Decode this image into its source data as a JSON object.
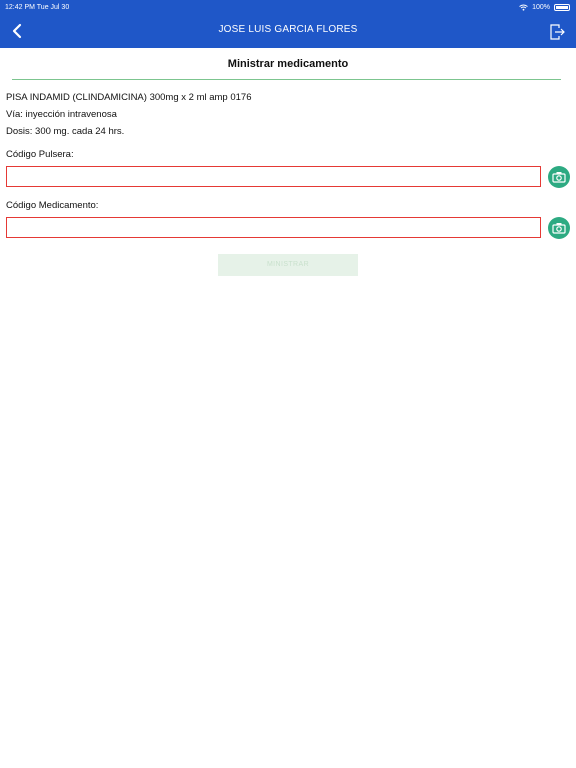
{
  "status_bar": {
    "time_date": "12:42 PM  Tue Jul 30",
    "battery": "100%"
  },
  "header": {
    "patient_name": "JOSE LUIS  GARCIA  FLORES"
  },
  "screen": {
    "title": "Ministrar medicamento"
  },
  "medication": {
    "name": "PISA INDAMID (CLINDAMICINA) 300mg x 2 ml amp 0176",
    "route": "Vía: inyección intravenosa",
    "dose": "Dosis: 300 mg. cada 24 hrs."
  },
  "form": {
    "bracelet_label": "Código Pulsera:",
    "bracelet_value": "",
    "medication_label": "Código Medicamento:",
    "medication_value": "",
    "submit_label": "MINISTRAR"
  },
  "icons": {
    "back": "chevron-left-icon",
    "logout": "logout-icon",
    "camera": "camera-icon",
    "wifi": "wifi-icon",
    "battery": "battery-icon"
  },
  "colors": {
    "header": "#1f57c8",
    "divider": "#7cc58f",
    "field_error": "#e53935",
    "camera_button": "#2daa82",
    "submit_disabled": "#e6f2e8"
  }
}
